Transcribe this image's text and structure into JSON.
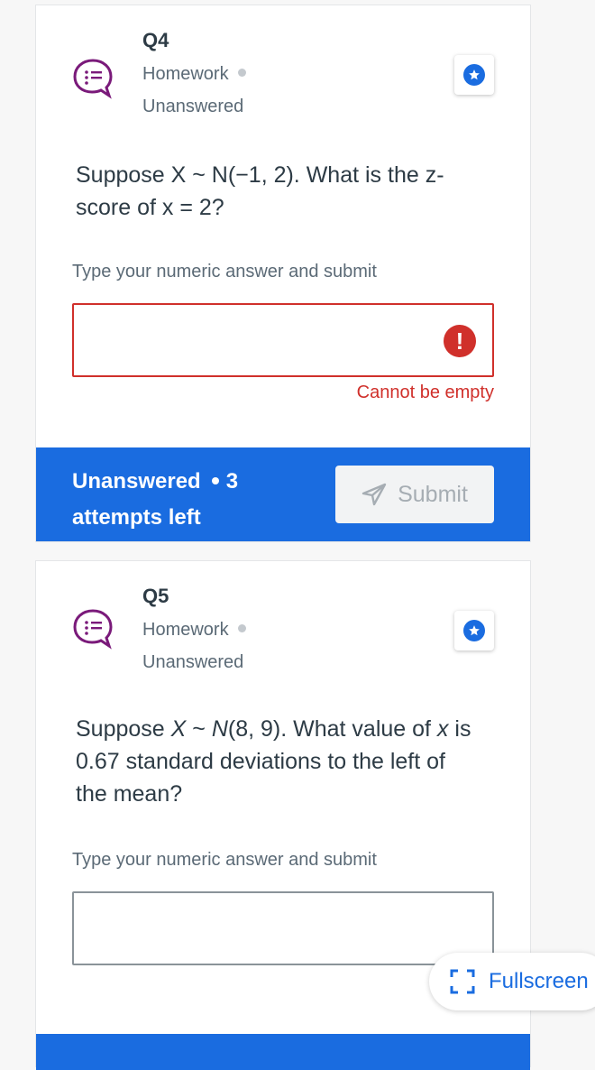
{
  "questions": [
    {
      "number": "Q4",
      "type": "Homework",
      "status": "Unanswered",
      "text": "Suppose X ~ N(−1, 2). What is the z-score of x = 2?",
      "prompt": "Type your numeric answer and submit",
      "input_value": "",
      "error_badge": "!",
      "error": "Cannot be empty",
      "footer": {
        "status": "Unanswered",
        "attempts": "3 attempts left",
        "submit_label": "Submit"
      }
    },
    {
      "number": "Q5",
      "type": "Homework",
      "status": "Unanswered",
      "text_parts": [
        "Suppose ",
        "X",
        " ~ ",
        "N",
        "(8, 9). What value of ",
        "x",
        " is 0.67 standard deviations to the left of the mean?"
      ],
      "prompt": "Type your numeric answer and submit",
      "input_value": ""
    }
  ],
  "fullscreen_label": "Fullscreen",
  "colors": {
    "accent": "#1a6ce0",
    "error": "#d0302b",
    "icon_purple": "#7a1a7a"
  },
  "icons": {
    "question_type": "chat-bubble-list-icon",
    "star": "star-icon",
    "submit": "send-arrow-icon",
    "fullscreen": "fullscreen-icon",
    "error": "exclamation-icon"
  }
}
